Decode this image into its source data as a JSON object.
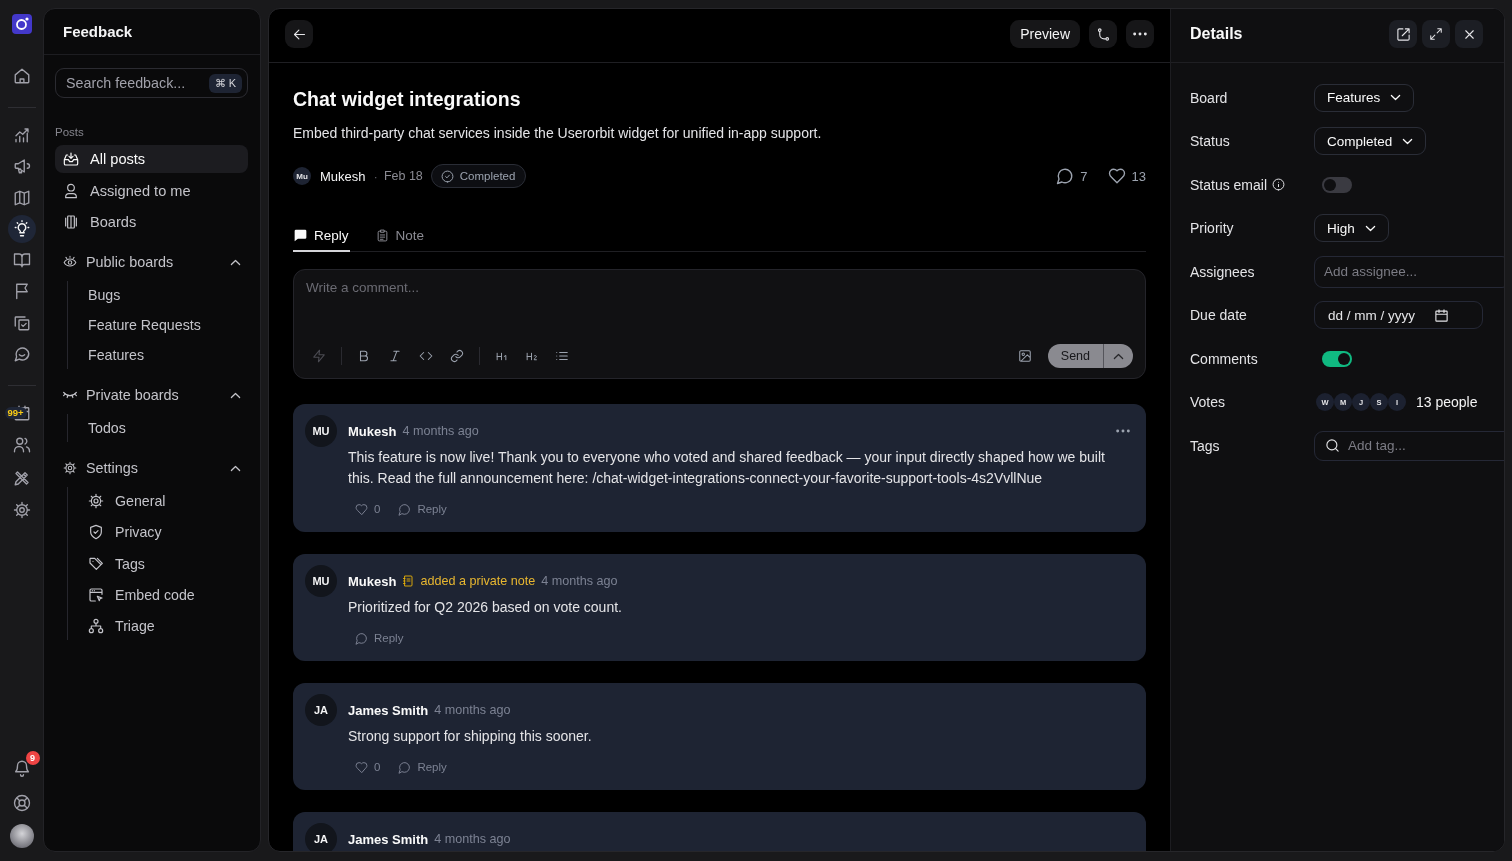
{
  "rail": {
    "groups": [
      {
        "items": [
          {
            "selected": false
          }
        ]
      },
      {
        "items": [
          {
            "selected": false
          },
          {
            "selected": false
          },
          {
            "selected": false
          },
          {
            "selected": true
          },
          {
            "selected": false
          },
          {
            "selected": false
          },
          {
            "selected": false
          },
          {
            "selected": false
          }
        ]
      },
      {
        "items": [
          {
            "selected": false,
            "badge": "99+"
          },
          {
            "selected": false
          },
          {
            "selected": false
          },
          {
            "selected": false
          }
        ]
      }
    ],
    "notifications": {
      "badge": "9"
    }
  },
  "sidebar": {
    "title": "Feedback",
    "search": {
      "placeholder": "Search feedback...",
      "shortcut": "⌘ K"
    },
    "section": "Posts",
    "items": [
      {
        "label": "All posts",
        "selected": true
      },
      {
        "label": "Assigned to me",
        "selected": false
      },
      {
        "label": "Boards",
        "selected": false
      }
    ],
    "groups": [
      {
        "label": "Public boards",
        "kind": "boards",
        "expanded": true,
        "children": [
          {
            "label": "Bugs",
            "selected": false
          },
          {
            "label": "Feature Requests",
            "selected": false
          },
          {
            "label": "Features",
            "selected": false
          }
        ]
      },
      {
        "label": "Private boards",
        "kind": "boards",
        "expanded": true,
        "children": [
          {
            "label": "Todos",
            "selected": false
          }
        ]
      },
      {
        "label": "Settings",
        "kind": "settings",
        "expanded": true,
        "children": [
          {
            "label": "General",
            "selected": false
          },
          {
            "label": "Privacy",
            "selected": false
          },
          {
            "label": "Tags",
            "selected": false
          },
          {
            "label": "Embed code",
            "selected": false
          },
          {
            "label": "Triage",
            "selected": false
          }
        ]
      }
    ]
  },
  "header": {
    "preview": "Preview"
  },
  "post": {
    "title": "Chat widget integrations",
    "description": "Embed third-party chat services inside the Userorbit widget for unified in-app support.",
    "author": {
      "initials": "Mu",
      "name": "Mukesh"
    },
    "separator": "·",
    "date": "Feb 18",
    "status": "Completed",
    "comments": "7",
    "votes": "13"
  },
  "tabs": [
    {
      "label": "Reply",
      "selected": true
    },
    {
      "label": "Note",
      "selected": false
    }
  ],
  "composer": {
    "placeholder": "Write a comment...",
    "send": "Send"
  },
  "comments": [
    {
      "kind": "reply",
      "initials": "MU",
      "author": "Mukesh",
      "time": "4 months ago",
      "menu": true,
      "text": "This feature is now live! Thank you to everyone who voted and shared feedback — your input directly shaped how we built this. Read the full announcement here: /chat-widget-integrations-connect-your-favorite-support-tools-4s2VvllNue",
      "likes": "0",
      "reply": "Reply"
    },
    {
      "kind": "note",
      "initials": "MU",
      "author": "Mukesh",
      "action": "added a private note",
      "time": "4 months ago",
      "menu": false,
      "text": "Prioritized for Q2 2026 based on vote count.",
      "reply": "Reply"
    },
    {
      "kind": "reply",
      "initials": "JA",
      "author": "James Smith",
      "time": "4 months ago",
      "menu": false,
      "text": "Strong support for shipping this sooner.",
      "likes": "0",
      "reply": "Reply"
    },
    {
      "kind": "reply",
      "initials": "JA",
      "author": "James Smith",
      "time": "4 months ago",
      "menu": false
    }
  ],
  "details": {
    "title": "Details",
    "fields": [
      {
        "kind": "select",
        "label": "Board",
        "value": "Features"
      },
      {
        "kind": "select",
        "label": "Status",
        "value": "Completed"
      },
      {
        "kind": "toggle",
        "label": "Status email",
        "info": true,
        "on": false
      },
      {
        "kind": "select",
        "label": "Priority",
        "value": "High"
      },
      {
        "kind": "input",
        "label": "Assignees",
        "placeholder": "Add assignee..."
      },
      {
        "kind": "date",
        "label": "Due date",
        "placeholder": "dd / mm / yyyy"
      },
      {
        "kind": "toggle",
        "label": "Comments",
        "on": true
      },
      {
        "kind": "voters",
        "label": "Votes",
        "voters": [
          "W",
          "M",
          "J",
          "S",
          "I"
        ],
        "summary": "13 people"
      },
      {
        "kind": "search",
        "label": "Tags",
        "placeholder": "Add tag..."
      }
    ]
  }
}
